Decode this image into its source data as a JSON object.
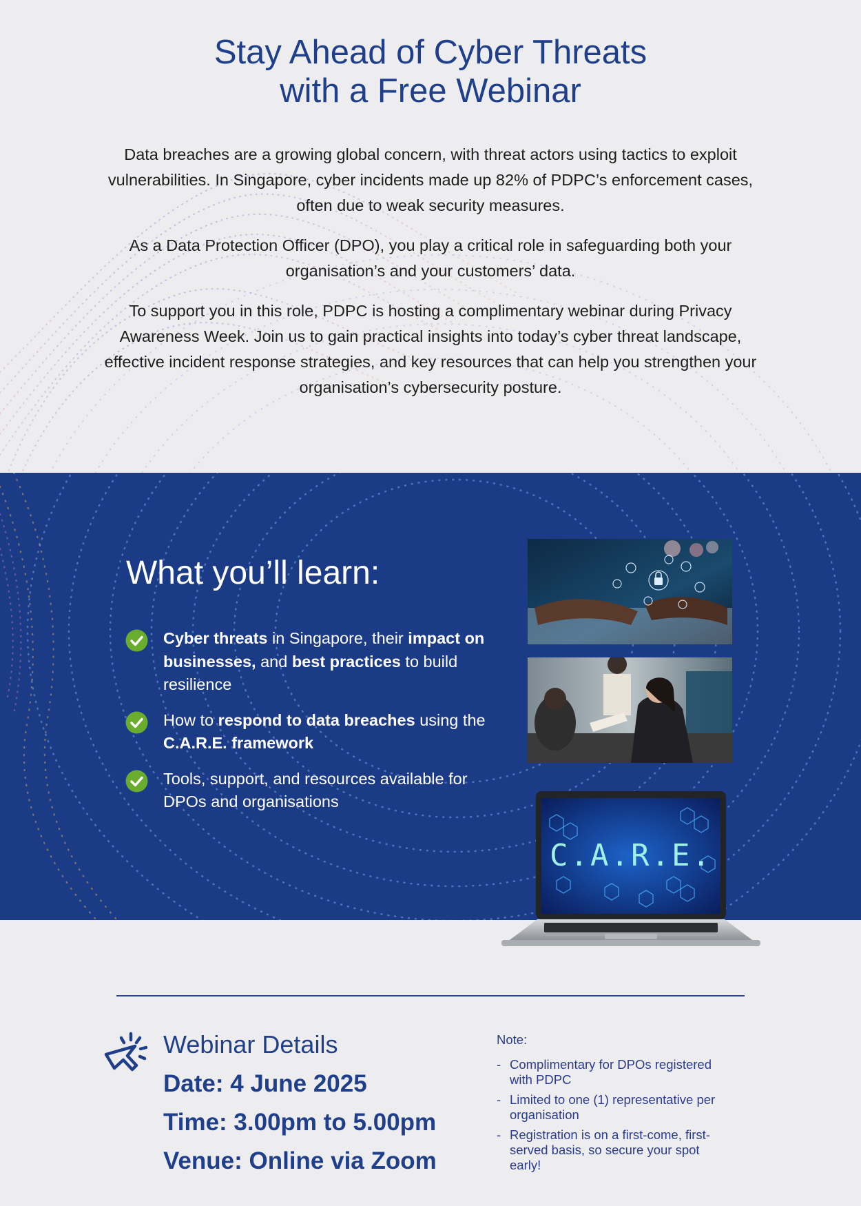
{
  "hero": {
    "title_line1": "Stay Ahead of Cyber Threats",
    "title_line2": "with a Free Webinar"
  },
  "intro": {
    "paragraph1": "Data breaches are a growing global concern, with threat actors using tactics to exploit vulnerabilities. In Singapore, cyber incidents made up 82% of PDPC’s enforcement cases, often due to weak security measures.",
    "paragraph2": "As a Data Protection Officer (DPO), you play a critical role in safeguarding both your organisation’s and your customers’ data.",
    "paragraph3": "To support you in this role, PDPC is hosting a complimentary webinar during Privacy Awareness Week. Join us to gain practical insights into today’s cyber threat landscape, effective incident response strategies, and key resources that can help you strengthen your organisation’s cybersecurity posture."
  },
  "learn": {
    "title": "What you’ll learn:",
    "bullet1": {
      "b1": "Cyber threats",
      "t1": " in Singapore, their ",
      "b2": "impact on businesses,",
      "t2": " and ",
      "b3": "best practices",
      "t3": " to build resilience"
    },
    "bullet2": {
      "t1": "How to ",
      "b1": "respond to data breaches",
      "t2": " using the ",
      "b2": "C.A.R.E. framework"
    },
    "bullet3": {
      "t1": "Tools, support, and resources available for DPOs and organisations"
    },
    "check_color": "#6aac2e"
  },
  "laptop": {
    "screen_text": "C.A.R.E."
  },
  "details": {
    "title": "Webinar Details",
    "date": "Date: 4 June 2025",
    "time": "Time: 3.00pm to 5.00pm",
    "venue": "Venue: Online via Zoom"
  },
  "note": {
    "title": "Note:",
    "items": [
      "Complimentary for DPOs registered with PDPC",
      "Limited to one (1) representative per organisation",
      "Registration is on a first-come, first-served basis, so secure your spot early!"
    ]
  },
  "colors": {
    "brand_blue": "#1f3f8a",
    "band_blue": "#1c3b86",
    "background": "#ededef",
    "check_green": "#6aac2e"
  }
}
